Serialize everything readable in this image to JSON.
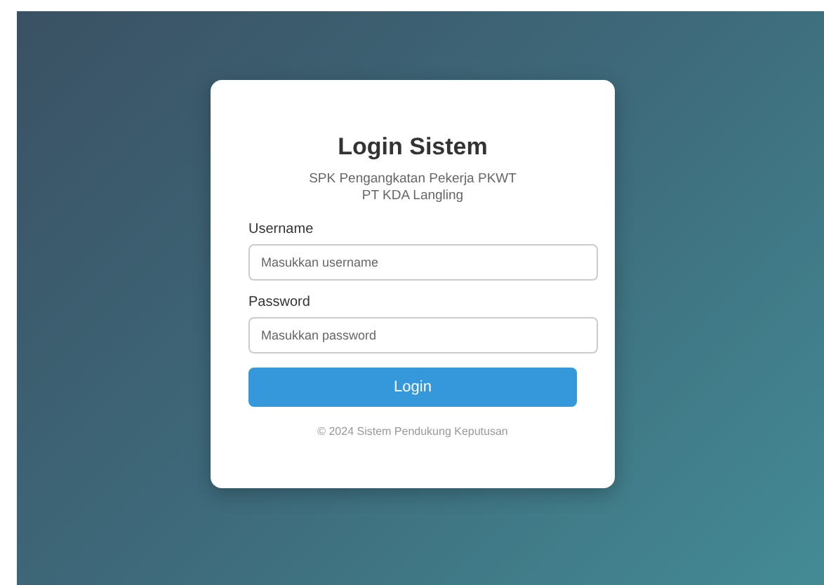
{
  "card": {
    "title": "Login Sistem",
    "subtitle_lines": [
      "SPK Pengangkatan Pekerja PKWT",
      "PT KDA Langling"
    ],
    "fields": [
      {
        "label": "Username",
        "placeholder": "Masukkan username"
      },
      {
        "label": "Password",
        "placeholder": "Masukkan password"
      }
    ],
    "button": "Login",
    "footer": "© 2024 Sistem Pendukung Keputusan"
  }
}
